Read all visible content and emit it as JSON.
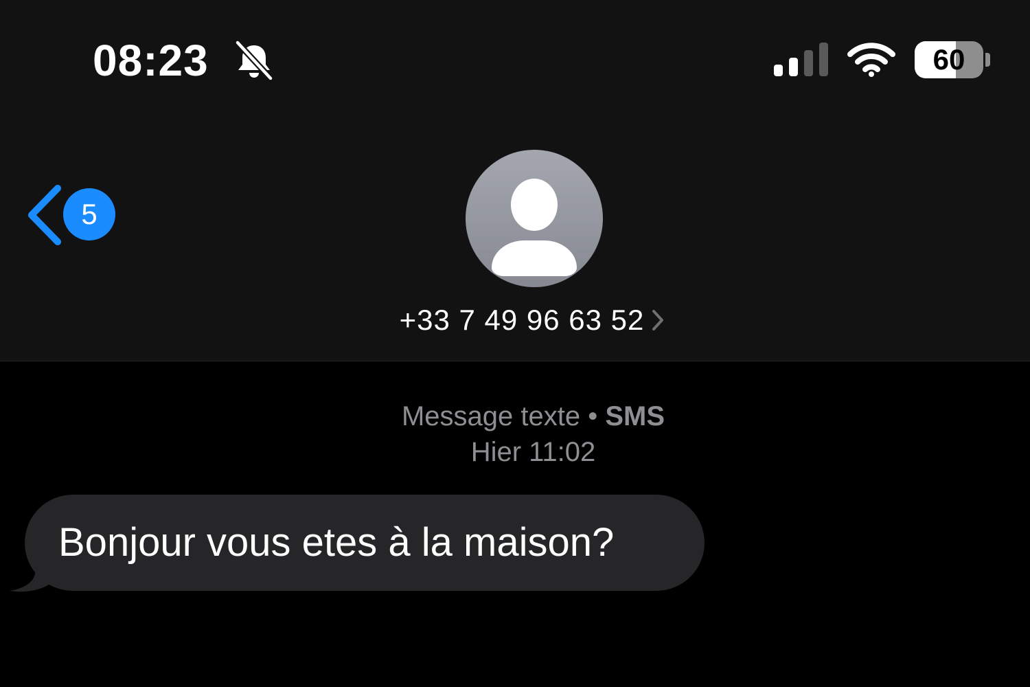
{
  "status_bar": {
    "time": "08:23",
    "silent_icon": "bell-slash-icon",
    "signal_icon": "cellular-signal-icon",
    "signal_bars": 2,
    "signal_bars_total": 4,
    "wifi_icon": "wifi-icon",
    "battery_level": "60",
    "battery_fraction": 0.6
  },
  "nav": {
    "back_icon": "chevron-left-icon",
    "unread_count": "5",
    "avatar_icon": "person-silhouette-icon",
    "contact": "+33 7 49 96 63 52",
    "contact_chevron_icon": "chevron-right-icon"
  },
  "conversation": {
    "service_label": "Message texte",
    "service_separator": "•",
    "service_type": "SMS",
    "timestamp": "Hier 11:02",
    "messages": [
      {
        "direction": "incoming",
        "text": "Bonjour vous etes à la maison?"
      }
    ]
  },
  "colors": {
    "accent": "#1a8cff",
    "header_background": "#121212",
    "background": "#000000",
    "incoming_bubble": "#262628",
    "secondary_text": "#8e8e93"
  }
}
